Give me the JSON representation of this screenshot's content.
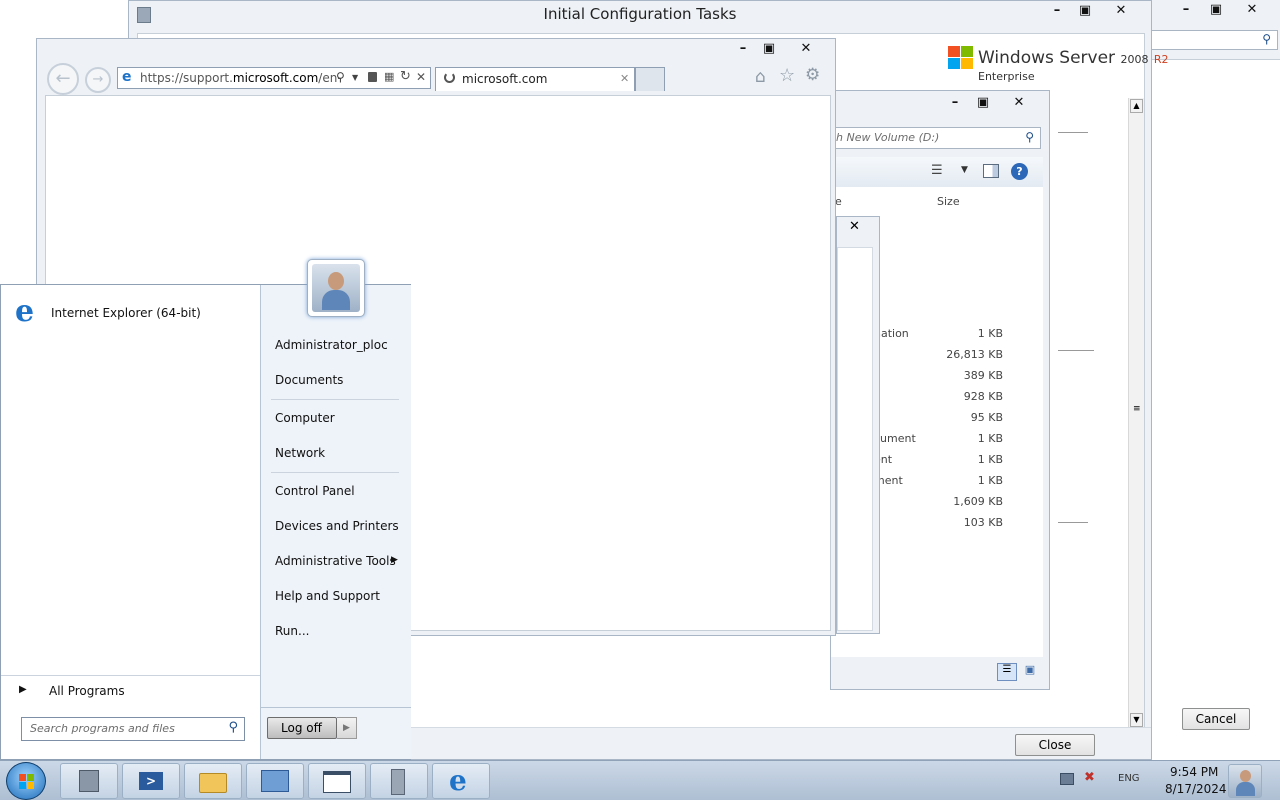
{
  "ict": {
    "title": "Initial Configuration Tasks",
    "brand_name": "Windows Server",
    "brand_version": "2008",
    "brand_edition_suffix": "R2",
    "brand_edition": "Enterprise",
    "cancel_label": "Cancel",
    "close_label": "Close"
  },
  "explorer": {
    "search_placeholder": "h New Volume (D:)",
    "column_partial": "e",
    "column_size": "Size",
    "rows": [
      {
        "name": "nation",
        "size": "1 KB"
      },
      {
        "name": "",
        "size": "26,813 KB"
      },
      {
        "name": "",
        "size": "389 KB"
      },
      {
        "name": "",
        "size": "928 KB"
      },
      {
        "name": "",
        "size": "95 KB"
      },
      {
        "name": "cument",
        "size": "1 KB"
      },
      {
        "name": "ent",
        "size": "1 KB"
      },
      {
        "name": "ment",
        "size": "1 KB"
      },
      {
        "name": "",
        "size": "1,609 KB"
      },
      {
        "name": "",
        "size": "103 KB"
      }
    ]
  },
  "ie": {
    "url_prefix": "https://support.",
    "url_domain": "microsoft.com",
    "url_rest": "/en-",
    "tab_label": "microsoft.com"
  },
  "start_menu": {
    "pinned": [
      {
        "label": "Internet Explorer (64-bit)"
      }
    ],
    "all_programs": "All Programs",
    "search_placeholder": "Search programs and files",
    "right_items": {
      "user": "Administrator_ploc",
      "documents": "Documents",
      "computer": "Computer",
      "network": "Network",
      "control_panel": "Control Panel",
      "devices": "Devices and Printers",
      "admin_tools": "Administrative Tools",
      "help": "Help and Support",
      "run": "Run..."
    },
    "logoff": "Log off"
  },
  "taskbar": {
    "lang": "ENG",
    "time": "9:54 PM",
    "date": "8/17/2024"
  },
  "colors": {
    "accent": "#1e73c9",
    "taskbar_top": "#cbd8e7",
    "start_right_bg": "#eef3f9"
  }
}
